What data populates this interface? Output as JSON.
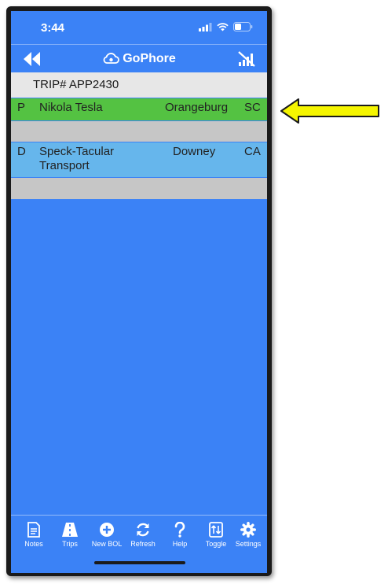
{
  "status_bar": {
    "time": "3:44"
  },
  "nav": {
    "brand": "GoPhore"
  },
  "trip": {
    "label": "TRIP# APP2430"
  },
  "stops": [
    {
      "type": "P",
      "name": "Nikola Tesla",
      "city": "Orangeburg",
      "state": "SC",
      "color": "#54c242"
    },
    {
      "type": "D",
      "name": "Speck-Tacular Transport",
      "city": "Downey",
      "state": "CA",
      "color": "#66b6ec"
    }
  ],
  "tabs": [
    {
      "label": "Notes",
      "icon": "notes-icon"
    },
    {
      "label": "Trips",
      "icon": "road-icon"
    },
    {
      "label": "New BOL",
      "icon": "plus-circle-icon"
    },
    {
      "label": "Refresh",
      "icon": "refresh-icon"
    },
    {
      "label": "Help",
      "icon": "question-icon"
    },
    {
      "label": "Toggle",
      "icon": "toggle-icon"
    },
    {
      "label": "Settings",
      "icon": "gear-icon"
    }
  ],
  "colors": {
    "app_blue": "#3b82f6",
    "arrow_yellow": "#f5f500"
  }
}
